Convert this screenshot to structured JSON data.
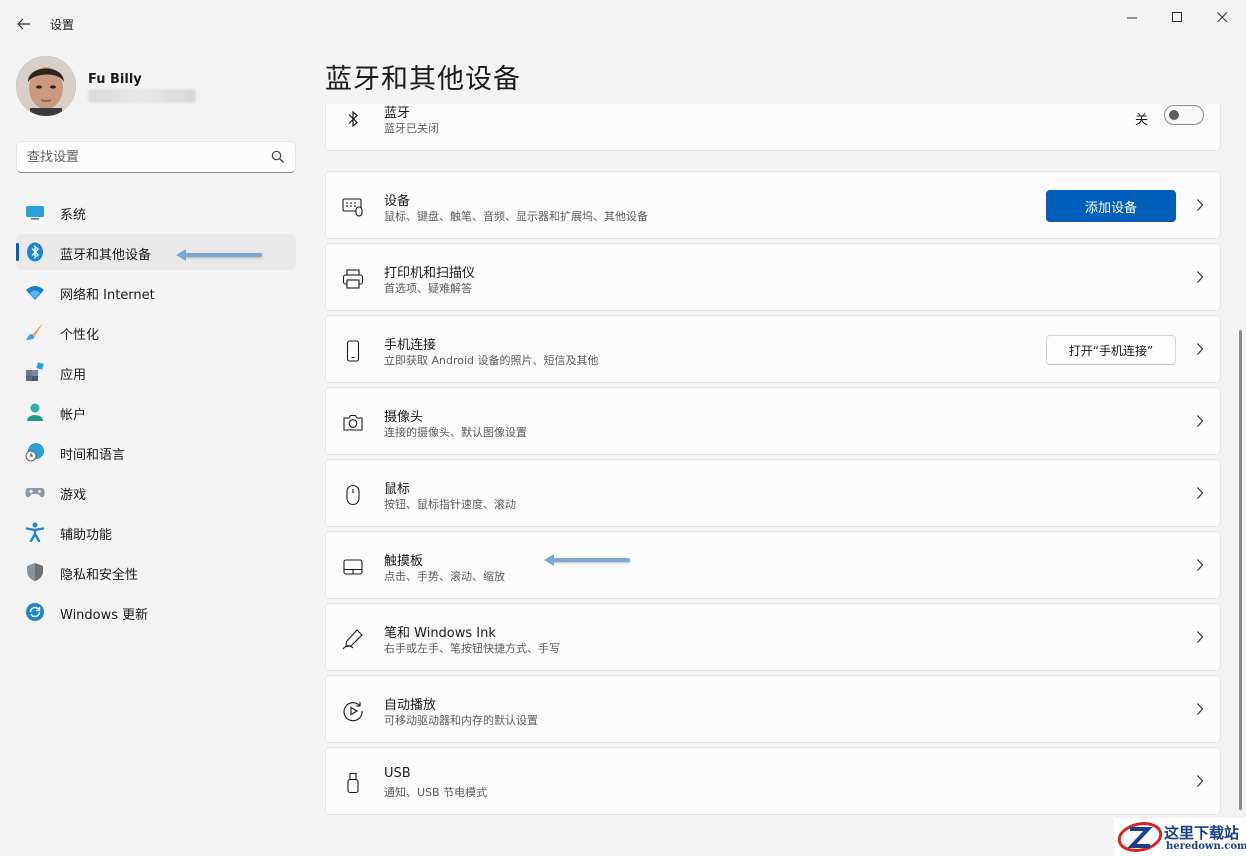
{
  "app": {
    "title": "设置"
  },
  "user": {
    "name": "Fu Billy"
  },
  "search": {
    "placeholder": "查找设置"
  },
  "nav": [
    {
      "label": "系统",
      "icon": "monitor-icon"
    },
    {
      "label": "蓝牙和其他设备",
      "icon": "bluetooth-icon",
      "active": true
    },
    {
      "label": "网络和 Internet",
      "icon": "wifi-icon"
    },
    {
      "label": "个性化",
      "icon": "brush-icon"
    },
    {
      "label": "应用",
      "icon": "apps-icon"
    },
    {
      "label": "帐户",
      "icon": "person-icon"
    },
    {
      "label": "时间和语言",
      "icon": "globe-clock-icon"
    },
    {
      "label": "游戏",
      "icon": "gamepad-icon"
    },
    {
      "label": "辅助功能",
      "icon": "accessibility-icon"
    },
    {
      "label": "隐私和安全性",
      "icon": "shield-icon"
    },
    {
      "label": "Windows 更新",
      "icon": "update-icon"
    }
  ],
  "page": {
    "title": "蓝牙和其他设备"
  },
  "bluetooth": {
    "title": "蓝牙",
    "subtitle": "蓝牙已关闭",
    "toggle_label": "关",
    "enabled": false
  },
  "cards": [
    {
      "id": "devices",
      "title": "设备",
      "subtitle": "鼠标、键盘、触笔、音频、显示器和扩展坞、其他设备",
      "icon": "devices-icon",
      "button": "添加设备"
    },
    {
      "id": "printers",
      "title": "打印机和扫描仪",
      "subtitle": "首选项、疑难解答",
      "icon": "printer-icon"
    },
    {
      "id": "phone",
      "title": "手机连接",
      "subtitle": "立即获取 Android 设备的照片、短信及其他",
      "icon": "phone-icon",
      "button": "打开“手机连接”"
    },
    {
      "id": "camera",
      "title": "摄像头",
      "subtitle": "连接的摄像头、默认图像设置",
      "icon": "camera-icon"
    },
    {
      "id": "mouse",
      "title": "鼠标",
      "subtitle": "按钮、鼠标指针速度、滚动",
      "icon": "mouse-icon"
    },
    {
      "id": "touchpad",
      "title": "触摸板",
      "subtitle": "点击、手势、滚动、缩放",
      "icon": "touchpad-icon"
    },
    {
      "id": "pen",
      "title": "笔和 Windows Ink",
      "subtitle": "右手或左手、笔按钮快捷方式、手写",
      "icon": "pen-icon"
    },
    {
      "id": "autoplay",
      "title": "自动播放",
      "subtitle": "可移动驱动器和内存的默认设置",
      "icon": "autoplay-icon"
    },
    {
      "id": "usb",
      "title": "USB",
      "subtitle": "通知、USB 节电模式",
      "icon": "usb-icon"
    }
  ],
  "colors": {
    "accent": "#005fb8",
    "background": "#f3f3f3",
    "card": "#fbfbfb",
    "annotation_arrow": "#7fa7cc"
  },
  "watermark": {
    "cn": "这里下载站",
    "en": "heredown.com"
  }
}
